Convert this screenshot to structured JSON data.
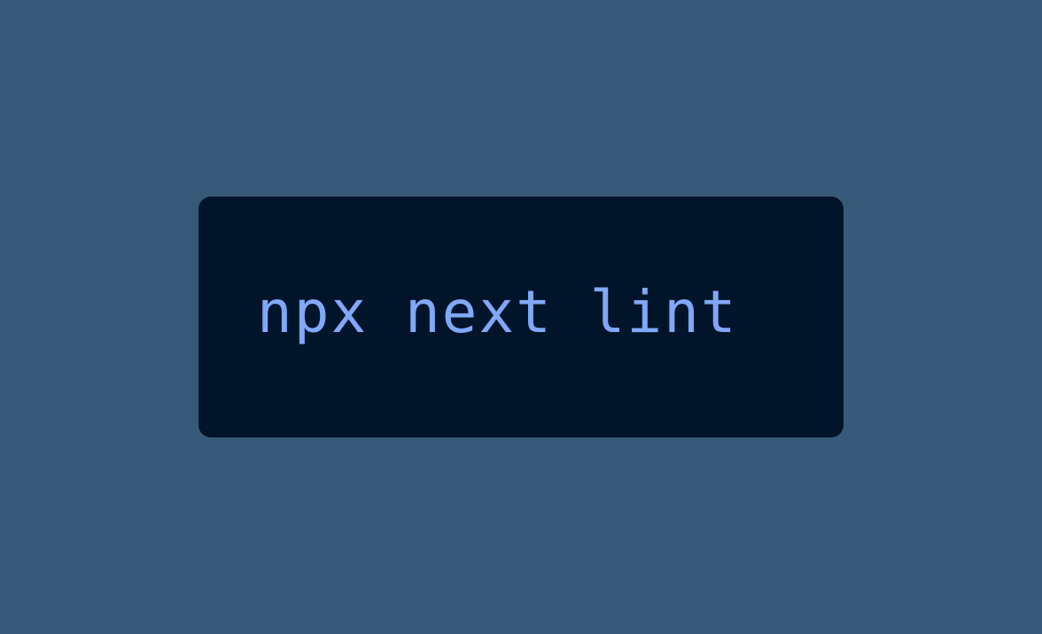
{
  "command": {
    "text": "npx next lint"
  },
  "colors": {
    "background": "#375a78",
    "code_block_background": "#00142a",
    "code_text": "#80a8f8"
  }
}
